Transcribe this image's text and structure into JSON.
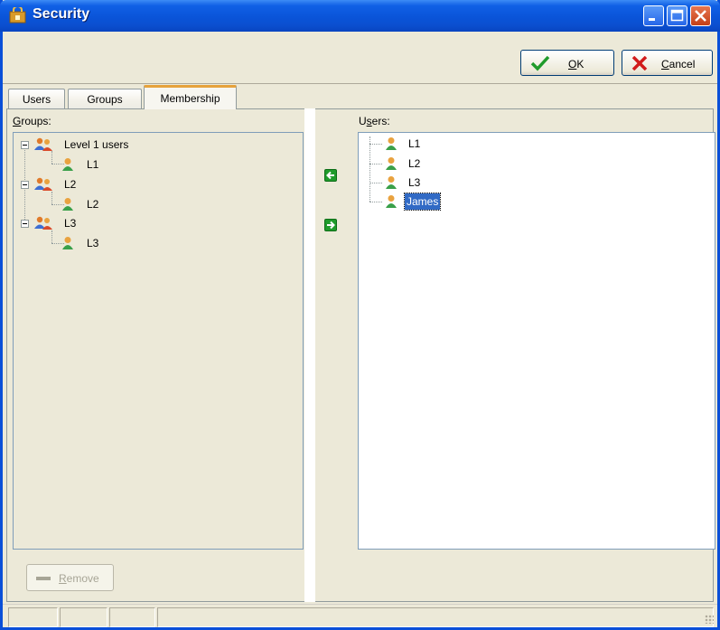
{
  "window": {
    "title": "Security"
  },
  "toolbar": {
    "ok_label": "OK",
    "ok_access": "O",
    "ok_rest": "K",
    "cancel_label": "Cancel",
    "cancel_access": "C",
    "cancel_rest": "ancel"
  },
  "tabs": [
    {
      "label": "Users",
      "active": false
    },
    {
      "label": "Groups",
      "active": false
    },
    {
      "label": "Membership",
      "active": true
    }
  ],
  "groups_pane": {
    "label": "Groups:",
    "label_access": "G",
    "label_rest": "roups:",
    "tree": [
      {
        "label": "Level 1 users",
        "icon": "group-icon",
        "children": [
          {
            "label": "L1",
            "icon": "user-icon"
          }
        ]
      },
      {
        "label": "L2",
        "icon": "group-icon",
        "children": [
          {
            "label": "L2",
            "icon": "user-icon"
          }
        ]
      },
      {
        "label": "L3",
        "icon": "group-icon",
        "children": [
          {
            "label": "L3",
            "icon": "user-icon"
          }
        ]
      }
    ]
  },
  "users_pane": {
    "label": "Users:",
    "label_first": "U",
    "label_access": "s",
    "label_rest": "ers:",
    "items": [
      {
        "label": "L1",
        "icon": "user-icon",
        "selected": false
      },
      {
        "label": "L2",
        "icon": "user-icon",
        "selected": false
      },
      {
        "label": "L3",
        "icon": "user-icon",
        "selected": false
      },
      {
        "label": "James",
        "icon": "user-icon",
        "selected": true
      }
    ]
  },
  "transfer": {
    "add_icon": "arrow-left-icon",
    "remove_icon": "arrow-right-icon"
  },
  "remove_button": {
    "label": "Remove",
    "label_access": "R",
    "label_rest": "emove",
    "enabled": false
  },
  "colors": {
    "title_bar": "#0a54d8",
    "selection": "#316ac5",
    "ok_check": "#1f9b2b",
    "cancel_x": "#d11b1b"
  }
}
